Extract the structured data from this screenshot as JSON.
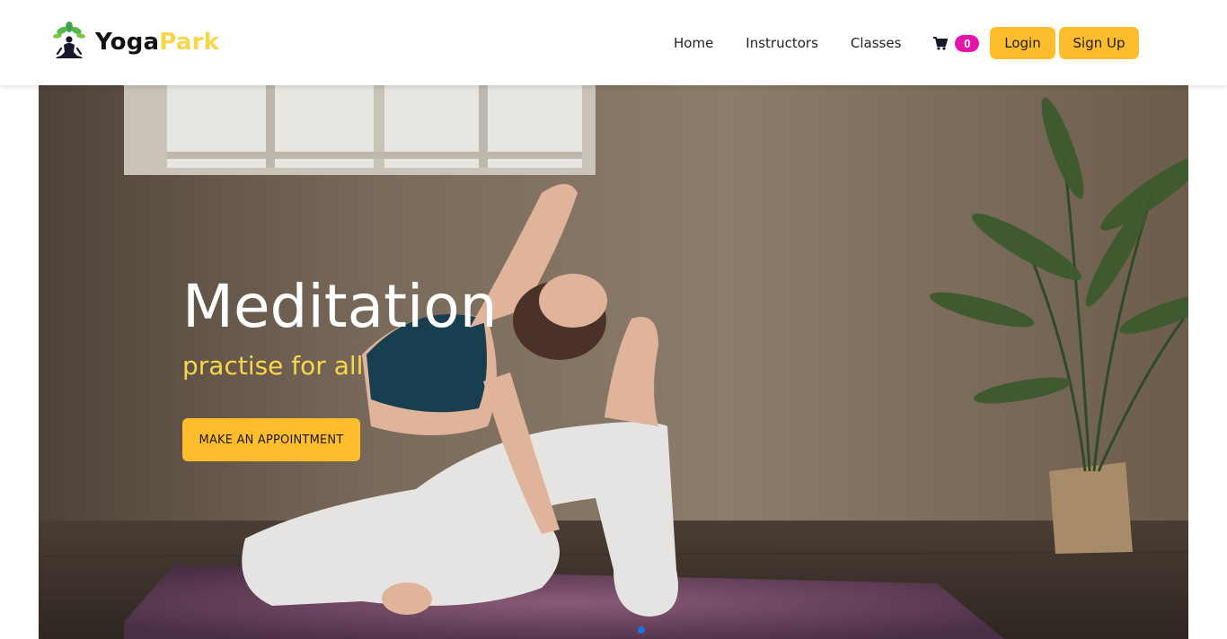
{
  "brand": {
    "part1": "Yoga",
    "part2": "Park",
    "logo_icon": "meditation-logo-icon"
  },
  "nav": {
    "links": [
      {
        "label": "Home"
      },
      {
        "label": "Instructors"
      },
      {
        "label": "Classes"
      }
    ],
    "cart": {
      "icon": "cart-icon",
      "count": "0"
    },
    "login_label": "Login",
    "signup_label": "Sign Up"
  },
  "hero": {
    "title": "Meditation",
    "subtitle": "practise for all",
    "cta_label": "MAKE AN APPOINTMENT",
    "carousel_active_index": 0
  },
  "colors": {
    "accent_yellow": "#fdbd2c",
    "brand_park": "#f8d54a",
    "badge_pink": "#e316a9",
    "dot_blue": "#1f73e0"
  }
}
